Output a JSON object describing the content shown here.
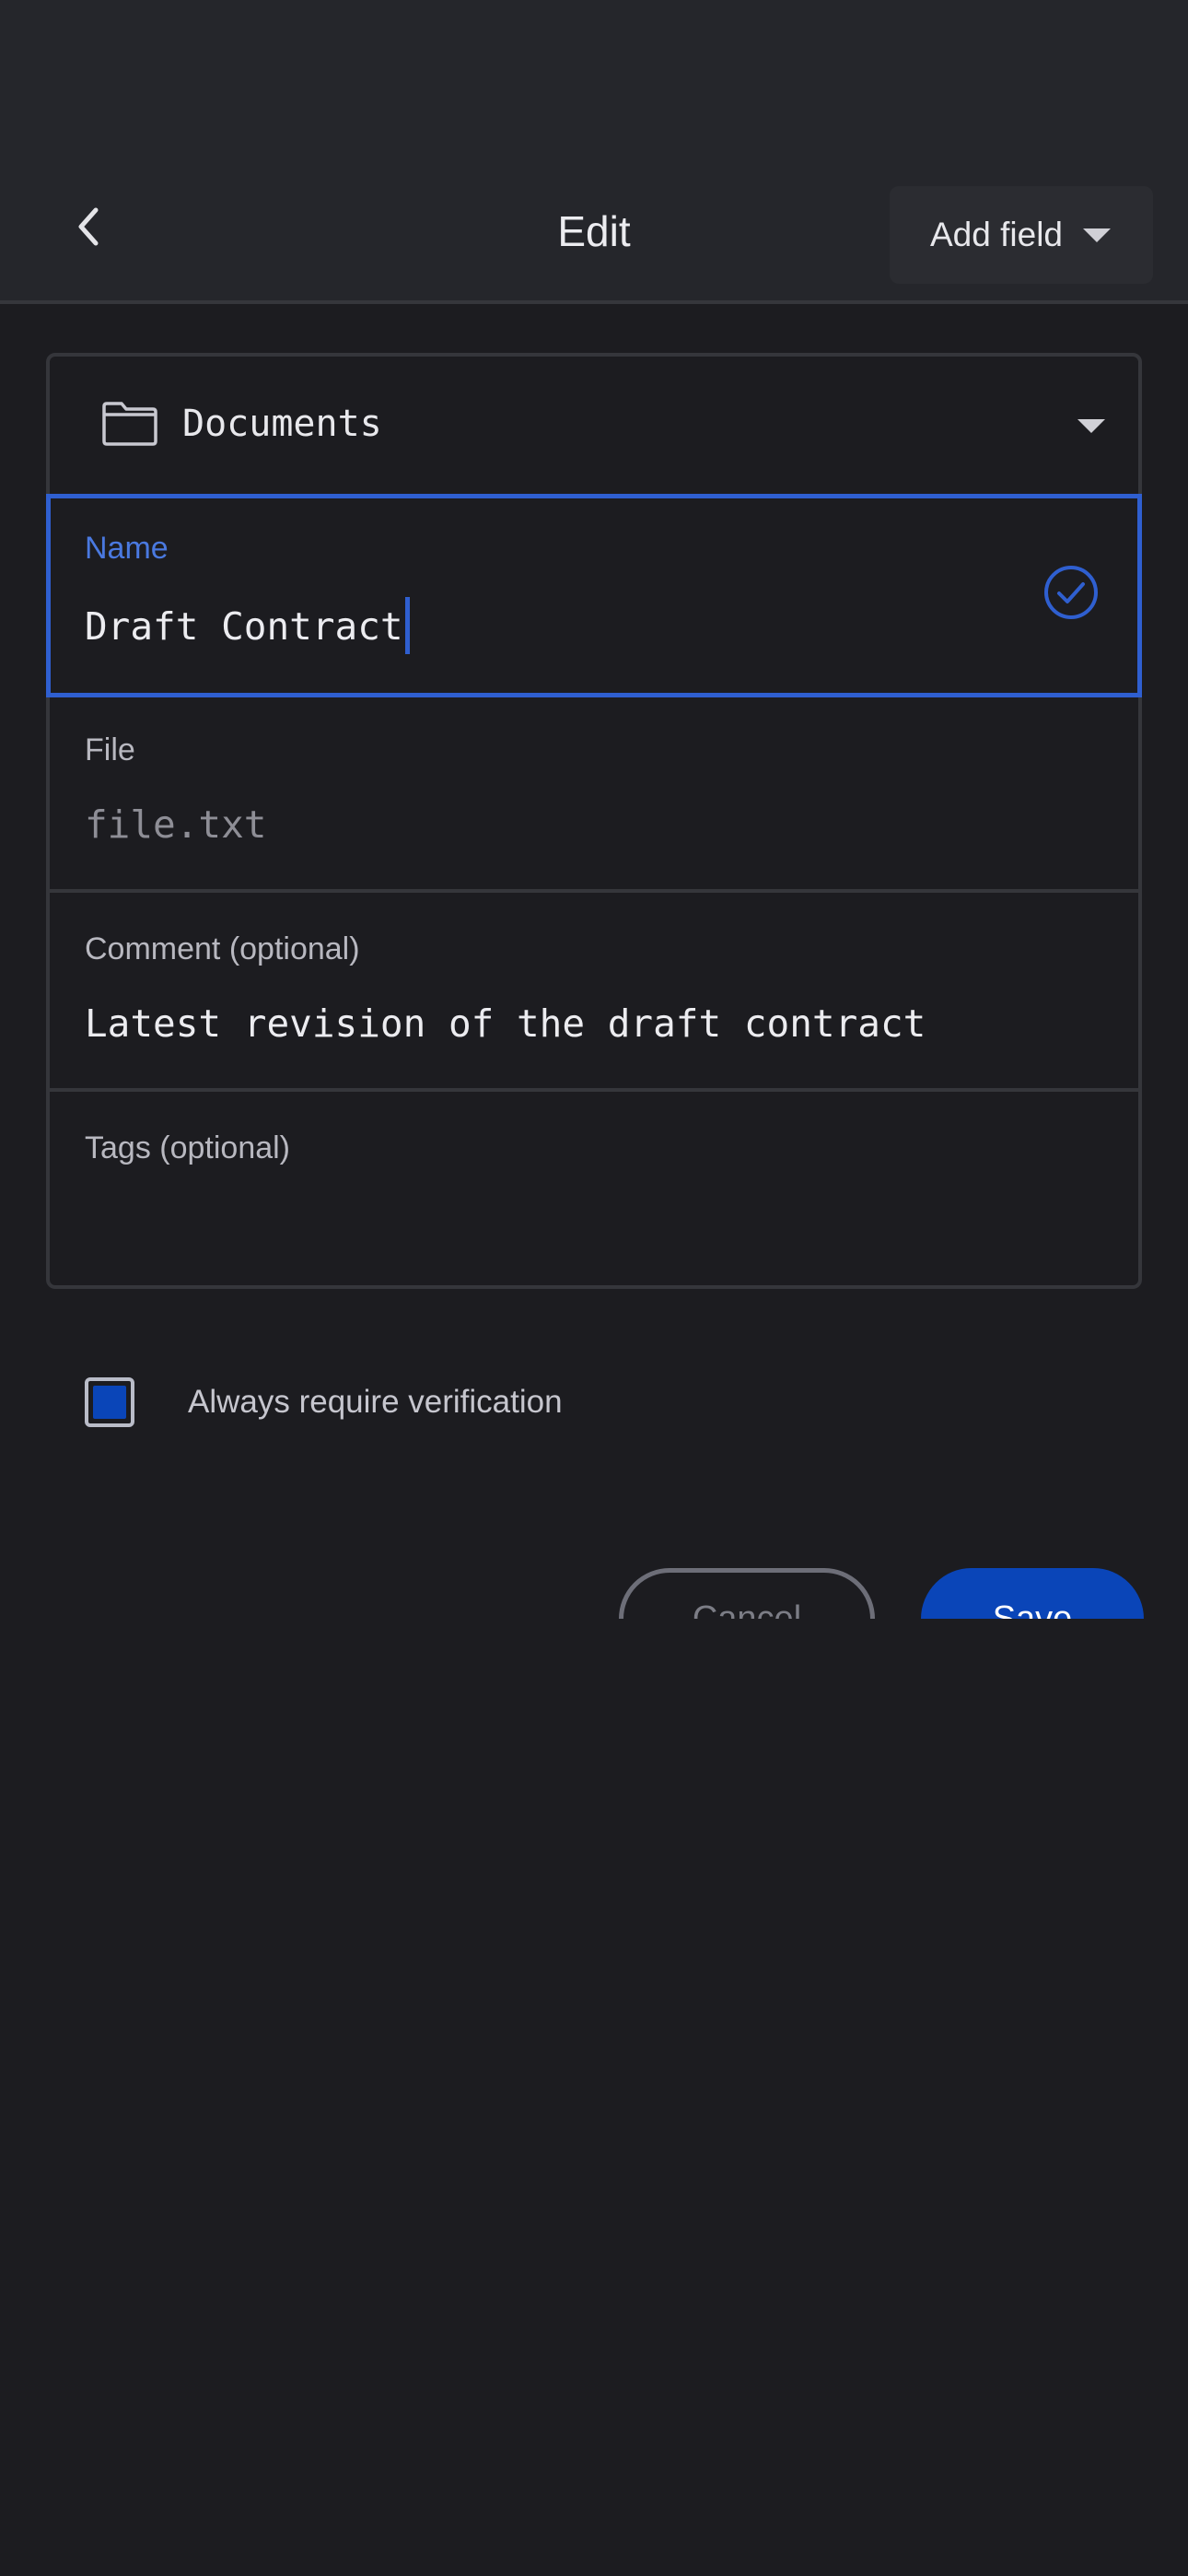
{
  "header": {
    "title": "Edit",
    "back_icon": "chevron-left-icon",
    "add_field_label": "Add field",
    "add_field_icon": "caret-down-icon"
  },
  "form": {
    "folder": {
      "icon": "folder-icon",
      "label": "Documents",
      "dropdown_icon": "caret-down-icon"
    },
    "fields": {
      "name": {
        "label": "Name",
        "value": "Draft Contract",
        "status_icon": "check-circle-icon",
        "focused": true
      },
      "file": {
        "label": "File",
        "value": "file.txt"
      },
      "comment": {
        "label": "Comment (optional)",
        "value": "Latest revision of the draft contract"
      },
      "tags": {
        "label": "Tags (optional)",
        "value": ""
      }
    }
  },
  "verification": {
    "label": "Always require verification",
    "checked": true
  },
  "actions": {
    "cancel_label": "Cancel",
    "save_label": "Save"
  },
  "colors": {
    "background": "#1c1c20",
    "header": "#25262b",
    "accent": "#2f5fd0",
    "primary_button": "#0a45b8"
  }
}
